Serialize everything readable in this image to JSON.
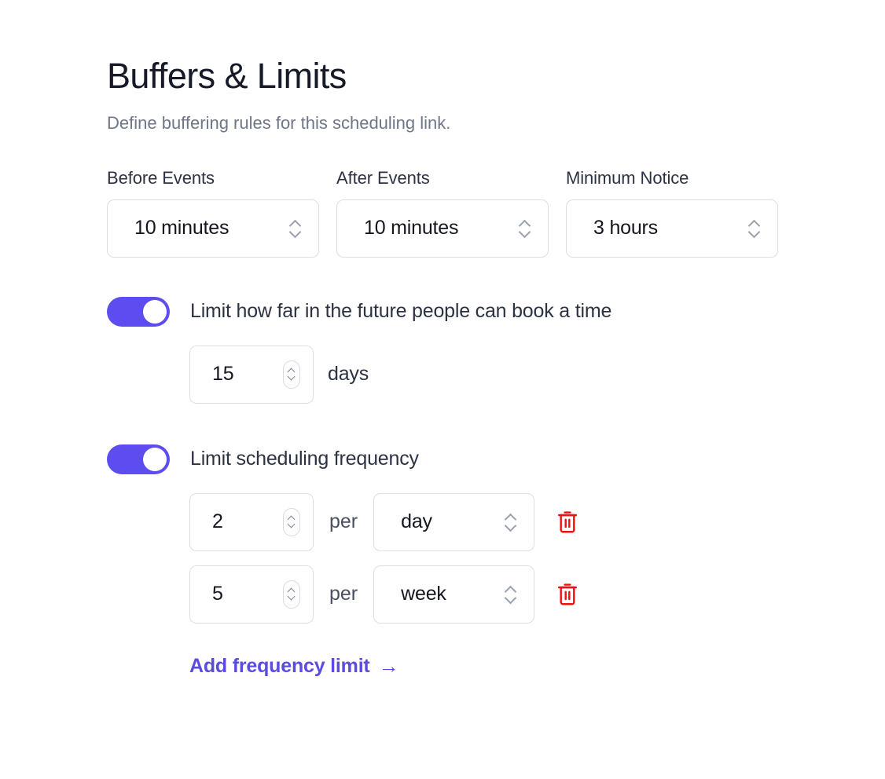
{
  "header": {
    "title": "Buffers & Limits",
    "subtitle": "Define buffering rules for this scheduling link."
  },
  "buffer_fields": [
    {
      "label": "Before Events",
      "value": "10 minutes"
    },
    {
      "label": "After Events",
      "value": "10 minutes"
    },
    {
      "label": "Minimum Notice",
      "value": "3 hours"
    }
  ],
  "future_limit": {
    "toggle_on": true,
    "label": "Limit how far in the future people can book a time",
    "value": "15",
    "unit": "days"
  },
  "frequency_limit": {
    "toggle_on": true,
    "label": "Limit scheduling frequency",
    "per_label": "per",
    "rows": [
      {
        "count": "2",
        "period": "day",
        "delete_icon": "trash-icon"
      },
      {
        "count": "5",
        "period": "week",
        "delete_icon": "trash-icon"
      }
    ],
    "add_link_label": "Add frequency limit",
    "add_link_arrow": "→"
  },
  "colors": {
    "accent": "#5D4DF0",
    "link": "#5B4BE0",
    "danger": "#EE1111",
    "text": "#2D3242",
    "muted": "#6F7687",
    "border": "#DCDEE4"
  }
}
